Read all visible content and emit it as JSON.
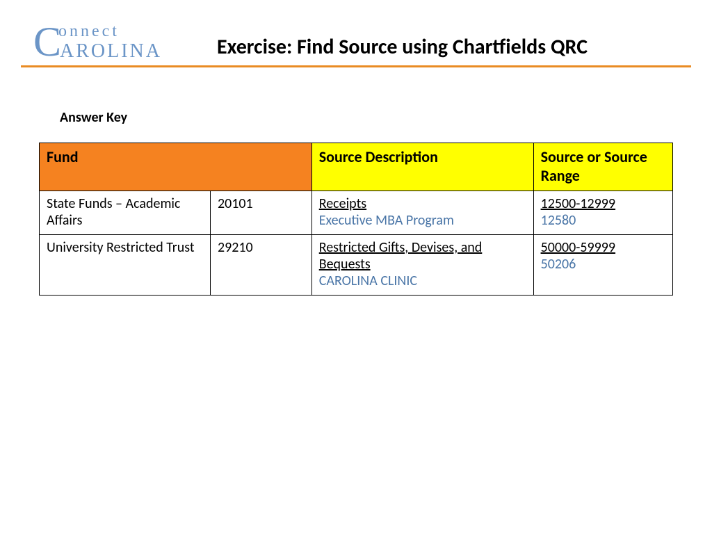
{
  "logo": {
    "top": "onnect",
    "C": "C",
    "bottom": "AROLINA"
  },
  "header": {
    "title": "Exercise: Find Source using Chartfields QRC"
  },
  "subheading": "Answer Key",
  "table": {
    "headers": {
      "fund": "Fund",
      "source_desc": "Source Description",
      "source_range": "Source or Source Range"
    },
    "rows": [
      {
        "fund_name": "State Funds – Academic Affairs",
        "fund_code": "20101",
        "desc_main": "Receipts",
        "desc_sub": "Executive MBA Program",
        "range": "12500-12999",
        "code": "12580"
      },
      {
        "fund_name": "University Restricted Trust",
        "fund_code": "29210",
        "desc_main": "Restricted Gifts, Devises, and Bequests",
        "desc_sub": "CAROLINA CLINIC",
        "range": "50000-59999",
        "code": "50206"
      }
    ]
  }
}
